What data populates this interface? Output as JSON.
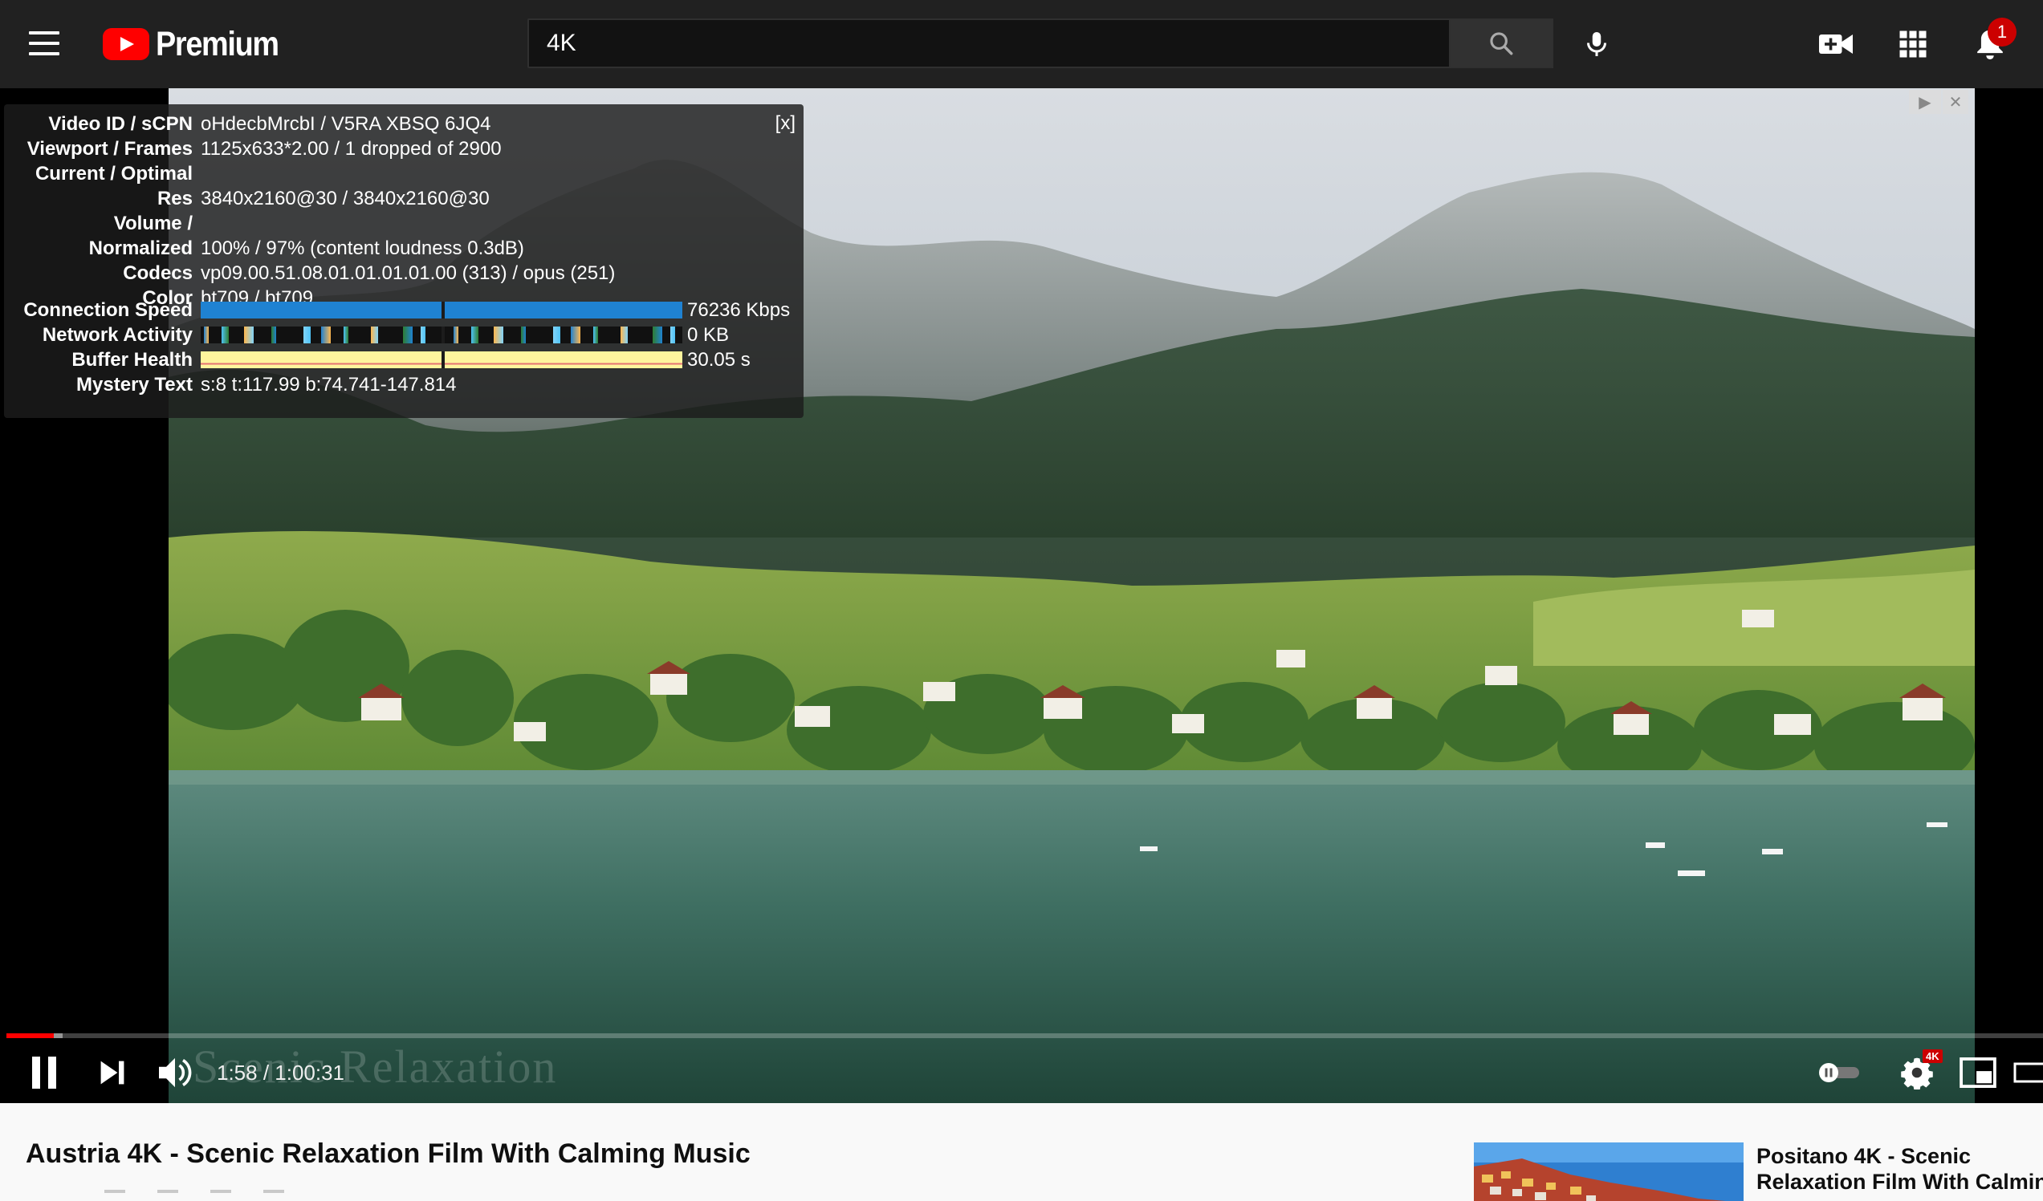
{
  "masthead": {
    "logo_text": "Premium",
    "search_value": "4K",
    "notification_count": "1",
    "icons": [
      "menu-icon",
      "youtube-logo-icon",
      "search-icon",
      "microphone-icon",
      "create-video-icon",
      "apps-grid-icon",
      "notifications-bell-icon"
    ]
  },
  "stats": {
    "close_label": "[x]",
    "rows": [
      {
        "label": "Video ID / sCPN",
        "value": "oHdecbMrcbI / V5RA XBSQ 6JQ4"
      },
      {
        "label": "Viewport / Frames",
        "value": "1125x633*2.00 / 1 dropped of 2900"
      },
      {
        "label": "Current / Optimal",
        "value": ""
      },
      {
        "label": "Res",
        "value": "3840x2160@30 / 3840x2160@30"
      },
      {
        "label": "Volume /",
        "value": ""
      },
      {
        "label": "Normalized",
        "value": "100% / 97% (content loudness 0.3dB)"
      },
      {
        "label": "Codecs",
        "value": "vp09.00.51.08.01.01.01.01.00 (313) / opus (251)"
      },
      {
        "label": "Color",
        "value": "bt709 / bt709"
      }
    ],
    "connection_speed": {
      "label": "Connection Speed",
      "value": "76236 Kbps"
    },
    "network_activity": {
      "label": "Network Activity",
      "value": "0 KB"
    },
    "buffer_health": {
      "label": "Buffer Health",
      "value": "30.05 s"
    },
    "mystery_text": {
      "label": "Mystery Text",
      "value": "s:8 t:117.99 b:74.741-147.814"
    }
  },
  "player": {
    "watermark": "Scenic Relaxation",
    "time_display": "1:58 / 1:00:31",
    "progress_played_fraction": 0.0233,
    "progress_buffered_fraction": 0.0275,
    "quality_badge": "4K",
    "icons": [
      "pause-icon",
      "next-icon",
      "volume-icon",
      "autoplay-toggle-icon",
      "settings-gear-icon",
      "miniplayer-icon",
      "theater-mode-icon"
    ]
  },
  "video": {
    "title": "Austria 4K - Scenic Relaxation Film With Calming Music"
  },
  "recommendation": {
    "title_line1": "Positano 4K - Scenic",
    "title_line2": "Relaxation Film With Calming"
  },
  "colors": {
    "masthead_bg": "#212121",
    "accent_red": "#ff0000",
    "stats_blue": "#1f82d2",
    "stats_yellow": "#fff59d"
  }
}
